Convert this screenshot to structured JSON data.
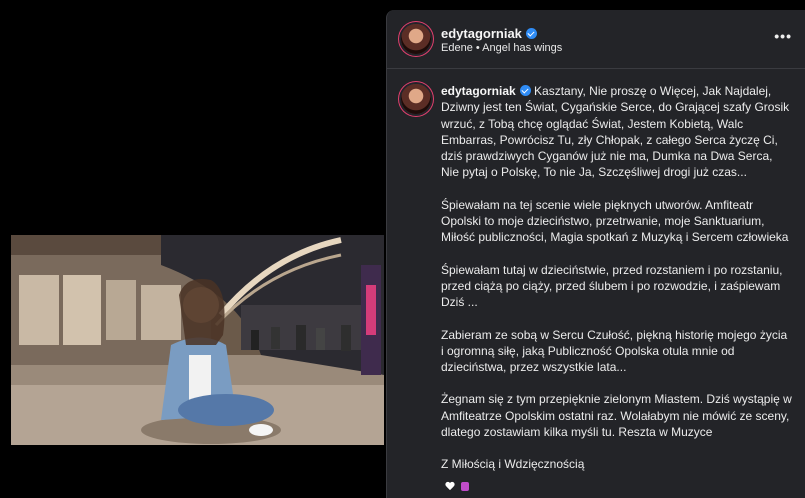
{
  "post": {
    "username": "edytagorniak",
    "subtitle": "Edene • Angel has wings",
    "more_label": "•••",
    "caption_paragraphs": [
      "Kasztany, Nie proszę o Więcej, Jak Najdalej, Dziwny jest ten Świat, Cygańskie Serce, do Grającej szafy Grosik wrzuć, z Tobą chcę oglądać Świat, Jestem Kobietą, Walc Embarras, Powrócisz Tu, zły Chłopak, z całego Serca życzę Ci, dziś prawdziwych Cyganów już nie ma, Dumka na Dwa Serca, Nie pytaj o Polskę, To nie Ja, Szczęśliwej drogi już czas...",
      "Śpiewałam na tej scenie wiele pięknych utworów. Amfiteatr Opolski to moje dzieciństwo, przetrwanie, moje Sanktuarium, Miłość publiczności, Magia spotkań z Muzyką i Sercem człowieka",
      "Śpiewałam tutaj w dzieciństwie, przed rozstaniem i po rozstaniu, przed ciążą po ciąży, przed ślubem i po rozwodzie, i zaśpiewam Dziś ...",
      "Zabieram ze sobą w Sercu Czułość, piękną historię mojego życia i ogromną siłę, jaką Publiczność Opolska otula mnie od dzieciństwa, przez wszystkie lata...",
      "Żegnam się z tym przepięknie zielonym Miastem. Dziś wystąpię w Amfiteatrze Opolskim ostatni raz. Wolałabym nie mówić ze sceny, dlatego zostawiam kilka myśli tu. Reszta w Muzyce",
      "Z Miłością i Wdzięcznością"
    ],
    "reactions": [
      "heart-icon",
      "gift-icon"
    ],
    "accent_color": "#2f8cf5",
    "panel_bg": "#232428"
  }
}
